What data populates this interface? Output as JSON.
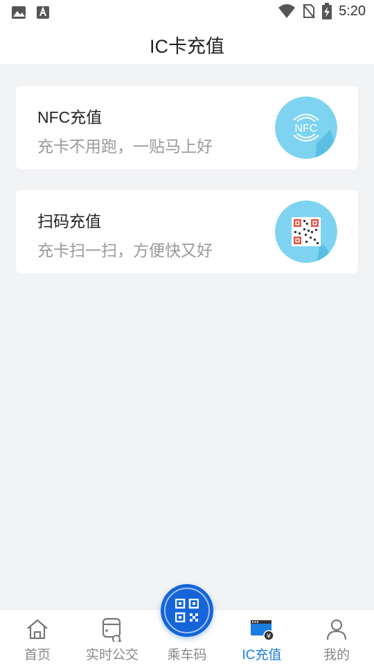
{
  "status_bar": {
    "time": "5:20",
    "icons": [
      "image-icon",
      "a-letter-icon",
      "wifi-icon",
      "no-sim-icon",
      "battery-charging-icon"
    ]
  },
  "header": {
    "title": "IC卡充值"
  },
  "cards": [
    {
      "title": "NFC充值",
      "subtitle": "充卡不用跑，一贴马上好",
      "icon": "nfc-icon",
      "icon_text": "NFC"
    },
    {
      "title": "扫码充值",
      "subtitle": "充卡扫一扫，方便快又好",
      "icon": "qr-code-icon"
    }
  ],
  "tabbar": {
    "items": [
      {
        "label": "首页",
        "icon": "home-icon",
        "active": false
      },
      {
        "label": "实时公交",
        "icon": "bus-search-icon",
        "active": false
      },
      {
        "label": "乘车码",
        "icon": "qr-code-icon",
        "active": false
      },
      {
        "label": "IC充值",
        "icon": "card-recharge-icon",
        "active": true
      },
      {
        "label": "我的",
        "icon": "user-icon",
        "active": false
      }
    ]
  },
  "colors": {
    "accent": "#1a7de0",
    "icon_circle": "#7dd3f0",
    "background": "#f2f3f5"
  }
}
